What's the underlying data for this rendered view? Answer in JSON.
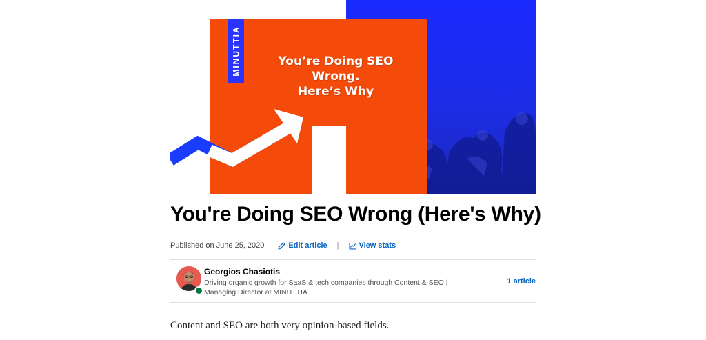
{
  "hero": {
    "brand": "MINUTTIA",
    "headline_line1": "You’re Doing SEO Wrong.",
    "headline_line2": "Here’s Why",
    "colors": {
      "orange": "#f44b0a",
      "blue": "#1d2de6",
      "arrow": "#ffffff",
      "stripe": "#1a3cff"
    }
  },
  "article": {
    "title": "You're Doing SEO Wrong (Here's Why)",
    "published": "Published on June 25, 2020",
    "edit_label": "Edit article",
    "separator": "|",
    "stats_label": "View stats",
    "body_first_line": "Content and SEO are both very opinion-based fields."
  },
  "author": {
    "name": "Georgios Chasiotis",
    "headline": "Driving organic growth for SaaS & tech companies through Content & SEO | Managing Director at MINUTTIA",
    "article_count": "1 article",
    "status": "online"
  },
  "icons": {
    "edit": "pencil-icon",
    "stats": "line-chart-icon"
  },
  "colors": {
    "link": "#0a66c2",
    "presence": "#057642"
  }
}
